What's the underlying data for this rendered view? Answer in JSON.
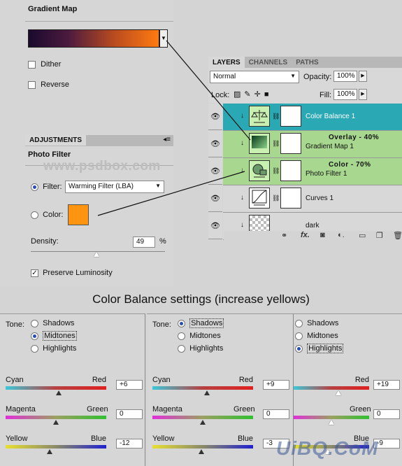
{
  "gradient_map": {
    "title": "Gradient Map",
    "dither_label": "Dither",
    "reverse_label": "Reverse",
    "dither_checked": false,
    "reverse_checked": false
  },
  "adjustments": {
    "tab_label": "ADJUSTMENTS",
    "title": "Photo Filter",
    "watermark": "www.psdbox.com",
    "filter_label": "Filter:",
    "filter_value": "Warming Filter (LBA)",
    "color_label": "Color:",
    "filter_color": "#ff9410",
    "density_label": "Density:",
    "density_value": "49",
    "density_unit": "%",
    "preserve_label": "Preserve Luminosity",
    "preserve_checked": true
  },
  "layers_panel": {
    "tabs": [
      "LAYERS",
      "CHANNELS",
      "PATHS"
    ],
    "blend_mode": "Normal",
    "opacity_label": "Opacity:",
    "opacity_value": "100%",
    "lock_label": "Lock:",
    "fill_label": "Fill:",
    "fill_value": "100%",
    "layers": [
      {
        "name": "Color Balance 1",
        "note": "",
        "highlight": "selected"
      },
      {
        "name": "Gradient Map 1",
        "note": "Overlay - 40%",
        "highlight": "green"
      },
      {
        "name": "Photo Filter 1",
        "note": "Color - 70%",
        "highlight": "green"
      },
      {
        "name": "Curves 1",
        "note": "",
        "highlight": "none"
      },
      {
        "name": "dark",
        "note": "",
        "highlight": "none"
      }
    ],
    "footer_icons": [
      "link-icon",
      "fx-icon",
      "mask-icon",
      "adjustment-icon",
      "folder-icon",
      "new-layer-icon",
      "trash-icon"
    ]
  },
  "caption": "Color Balance settings (increase yellows)",
  "color_balance": {
    "tone_label": "Tone:",
    "tones": [
      "Shadows",
      "Midtones",
      "Highlights"
    ],
    "sliders": [
      {
        "left": "Cyan",
        "right": "Red"
      },
      {
        "left": "Magenta",
        "right": "Green"
      },
      {
        "left": "Yellow",
        "right": "Blue"
      }
    ],
    "panels": [
      {
        "selected_tone": 1,
        "values": [
          "+6",
          "0",
          "-12"
        ],
        "levels": [
          6,
          0,
          -12
        ]
      },
      {
        "selected_tone": 0,
        "values": [
          "+9",
          "0",
          "-3"
        ],
        "levels": [
          9,
          0,
          -3
        ]
      },
      {
        "selected_tone": 2,
        "values": [
          "+19",
          "0",
          "-9"
        ],
        "levels": [
          19,
          0,
          -9
        ]
      }
    ]
  },
  "watermark_bottom": "UiBQ.CoM",
  "colors": {
    "selected_layer": "#2aa8b4",
    "green_layer": "#a8d890",
    "accent_blue": "#2a4cb8"
  }
}
